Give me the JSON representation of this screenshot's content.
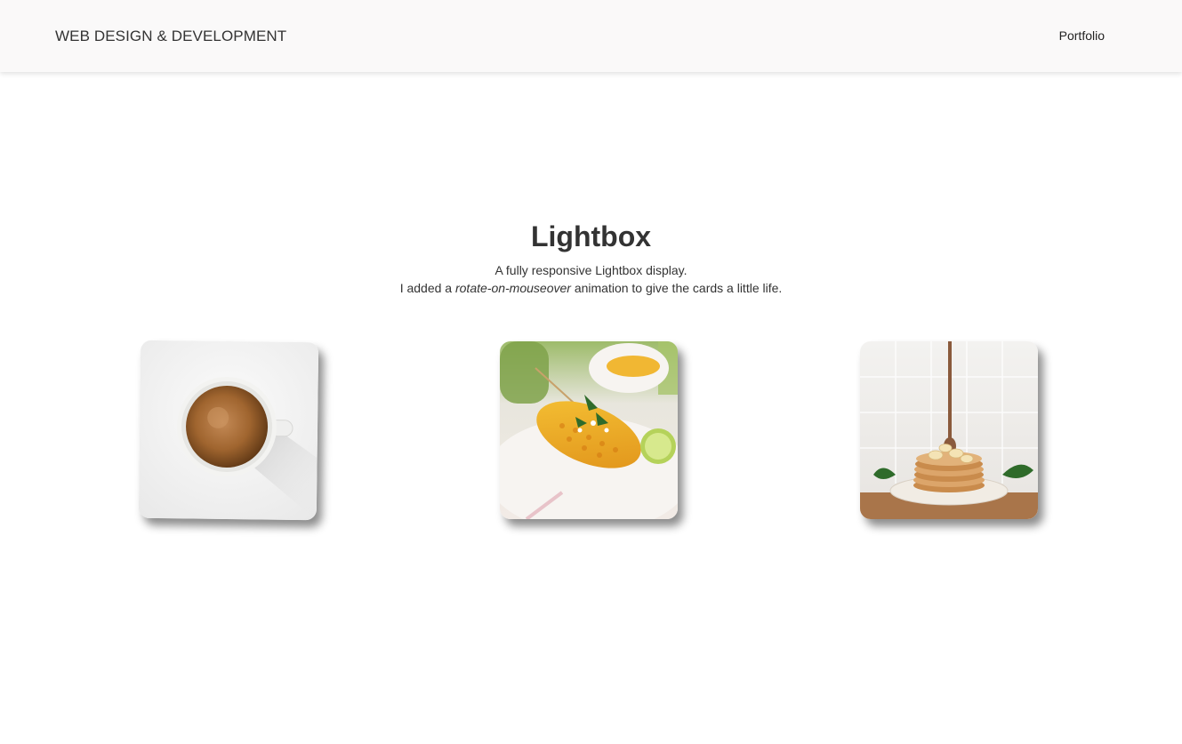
{
  "navbar": {
    "brand": "WEB DESIGN & DEVELOPMENT",
    "links": [
      "Portfolio"
    ]
  },
  "hero": {
    "title": "Lightbox",
    "line1": "A fully responsive Lightbox display.",
    "line2_pre": "I added a ",
    "line2_em": "rotate-on-mouseover",
    "line2_post": " animation to give the cards a little life."
  },
  "gallery": {
    "cards": [
      {
        "subject": "coffee-cup-photo"
      },
      {
        "subject": "grilled-corn-photo"
      },
      {
        "subject": "pancake-stack-photo"
      }
    ]
  },
  "colors": {
    "navbar_bg": "#faf9f9",
    "text": "#333333",
    "page_bg": "#ffffff"
  }
}
